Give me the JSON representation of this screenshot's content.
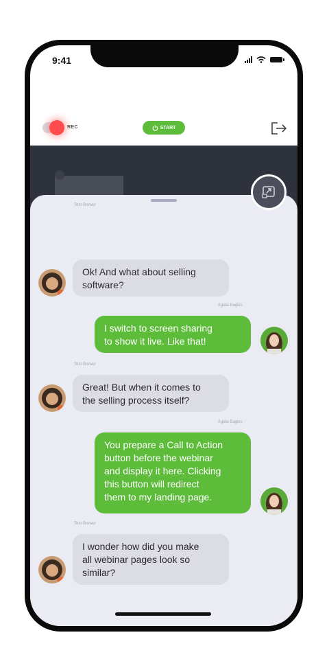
{
  "status_bar": {
    "time": "9:41"
  },
  "toolbar": {
    "rec_label": "REC",
    "start_label": "START"
  },
  "chat": {
    "messages": [
      {
        "sender": "Tom Brewer",
        "direction": "in",
        "text": "Ok! And what about selling\nsoftware?"
      },
      {
        "sender": "Agata Eagles",
        "direction": "out",
        "text": "I switch to screen sharing\nto show it live. Like that!"
      },
      {
        "sender": "Tom Brewer",
        "direction": "in",
        "text": "Great! But when it comes to\nthe selling process itself?"
      },
      {
        "sender": "Agata Eagles",
        "direction": "out",
        "text": "You prepare a Call to Action\nbutton before the webinar\nand display it here. Clicking\nthis button will redirect\nthem to my landing page."
      },
      {
        "sender": "Tom Brewer",
        "direction": "in",
        "text": "I wonder how did you make\nall webinar pages look so\nsimilar?"
      }
    ]
  },
  "colors": {
    "accent": "#5dbd3a",
    "rec": "#ff4b4b",
    "panel": "#ebebf3",
    "video_bg": "#2e323d"
  },
  "icons": {
    "exit": "exit-icon",
    "screen_share": "screen-share-icon",
    "power": "power-icon"
  }
}
